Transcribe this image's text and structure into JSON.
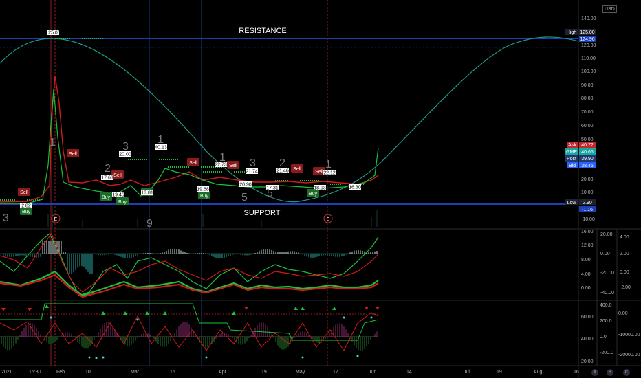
{
  "currency": "USD",
  "price_axis": {
    "main_ticks": [
      "140.00",
      "130.00",
      "120.00",
      "110.00",
      "100.00",
      "90.00",
      "80.00",
      "70.00",
      "60.00",
      "50.00",
      "40.00",
      "30.00",
      "20.00",
      "10.00",
      "-10.00"
    ],
    "high_label": "High",
    "high_value": "125.00",
    "resistance_value": "124.96",
    "ask_label": "Ask",
    "ask_value": "40.72",
    "last_label": "GME",
    "last_value": "40.66",
    "post_label": "Post",
    "post_value": "39.90",
    "bid_label": "Bid",
    "bid_value": "38.46",
    "low_label": "Low",
    "low_value": "2.90",
    "support_value": "-1.16"
  },
  "osc1_axis": {
    "left": [
      "20.00",
      "0.00",
      "-20.00",
      "-40.00"
    ],
    "mid": [
      "16.00",
      "12.00",
      "8.00",
      "4.00",
      "0.00"
    ],
    "right": [
      "4.00",
      "2.00",
      "0.00",
      "-2.00"
    ]
  },
  "osc2_axis": {
    "left": [
      "60.00",
      "40.00",
      "20.00"
    ],
    "mid": [
      "400.0",
      "200.0",
      "0.0",
      "-200.0"
    ],
    "right": [
      "0.00",
      "-10000.00",
      "-20000.00"
    ]
  },
  "time_axis": [
    "2021",
    "15:30",
    "Feb",
    "10",
    "Mar",
    "15",
    "Apr",
    "19",
    "May",
    "17",
    "Jun",
    "14",
    "Jul",
    "19",
    "Aug",
    "16"
  ],
  "axis_buttons": [
    "A",
    "B",
    "C"
  ],
  "zones": {
    "resistance": "RESISTANCE",
    "support": "SUPPORT"
  },
  "event_markers": [
    "E",
    "E"
  ],
  "signal_tags": [
    {
      "text": "Sell",
      "kind": "sell"
    },
    {
      "text": "Sell",
      "kind": "sell"
    },
    {
      "text": "Sell",
      "kind": "sell"
    },
    {
      "text": "Sell",
      "kind": "sell"
    },
    {
      "text": "Sell",
      "kind": "sell"
    },
    {
      "text": "Sell",
      "kind": "sell"
    },
    {
      "text": "Sell",
      "kind": "sell"
    },
    {
      "text": "Buy",
      "kind": "buy"
    },
    {
      "text": "Buy",
      "kind": "buy"
    },
    {
      "text": "Buy",
      "kind": "buy"
    },
    {
      "text": "Buy",
      "kind": "buy"
    },
    {
      "text": "Buy",
      "kind": "buy"
    },
    {
      "text": "Buy",
      "kind": "buy"
    }
  ],
  "price_tags": [
    "125.00",
    "2.82",
    "17.63",
    "19.46",
    "20.00",
    "13.81",
    "40.13",
    "19.68",
    "22.73",
    "20.90",
    "21.74",
    "17.31",
    "21.46",
    "18.93",
    "22.12",
    "16.30"
  ],
  "wave_numbers": [
    "1",
    "2",
    "3",
    "1",
    "3",
    "9",
    "1",
    "5",
    "2",
    "5",
    "1",
    "3"
  ],
  "colors": {
    "background": "#000000",
    "resistance_line": "#1a3fb8",
    "cycle_wave": "#1f9a8a",
    "sell_tag": "#8b1a1a",
    "buy_tag": "#1b6e2a",
    "price_red": "#d11a1a",
    "price_green": "#19c23a",
    "grid": "#1a1a1a"
  }
}
